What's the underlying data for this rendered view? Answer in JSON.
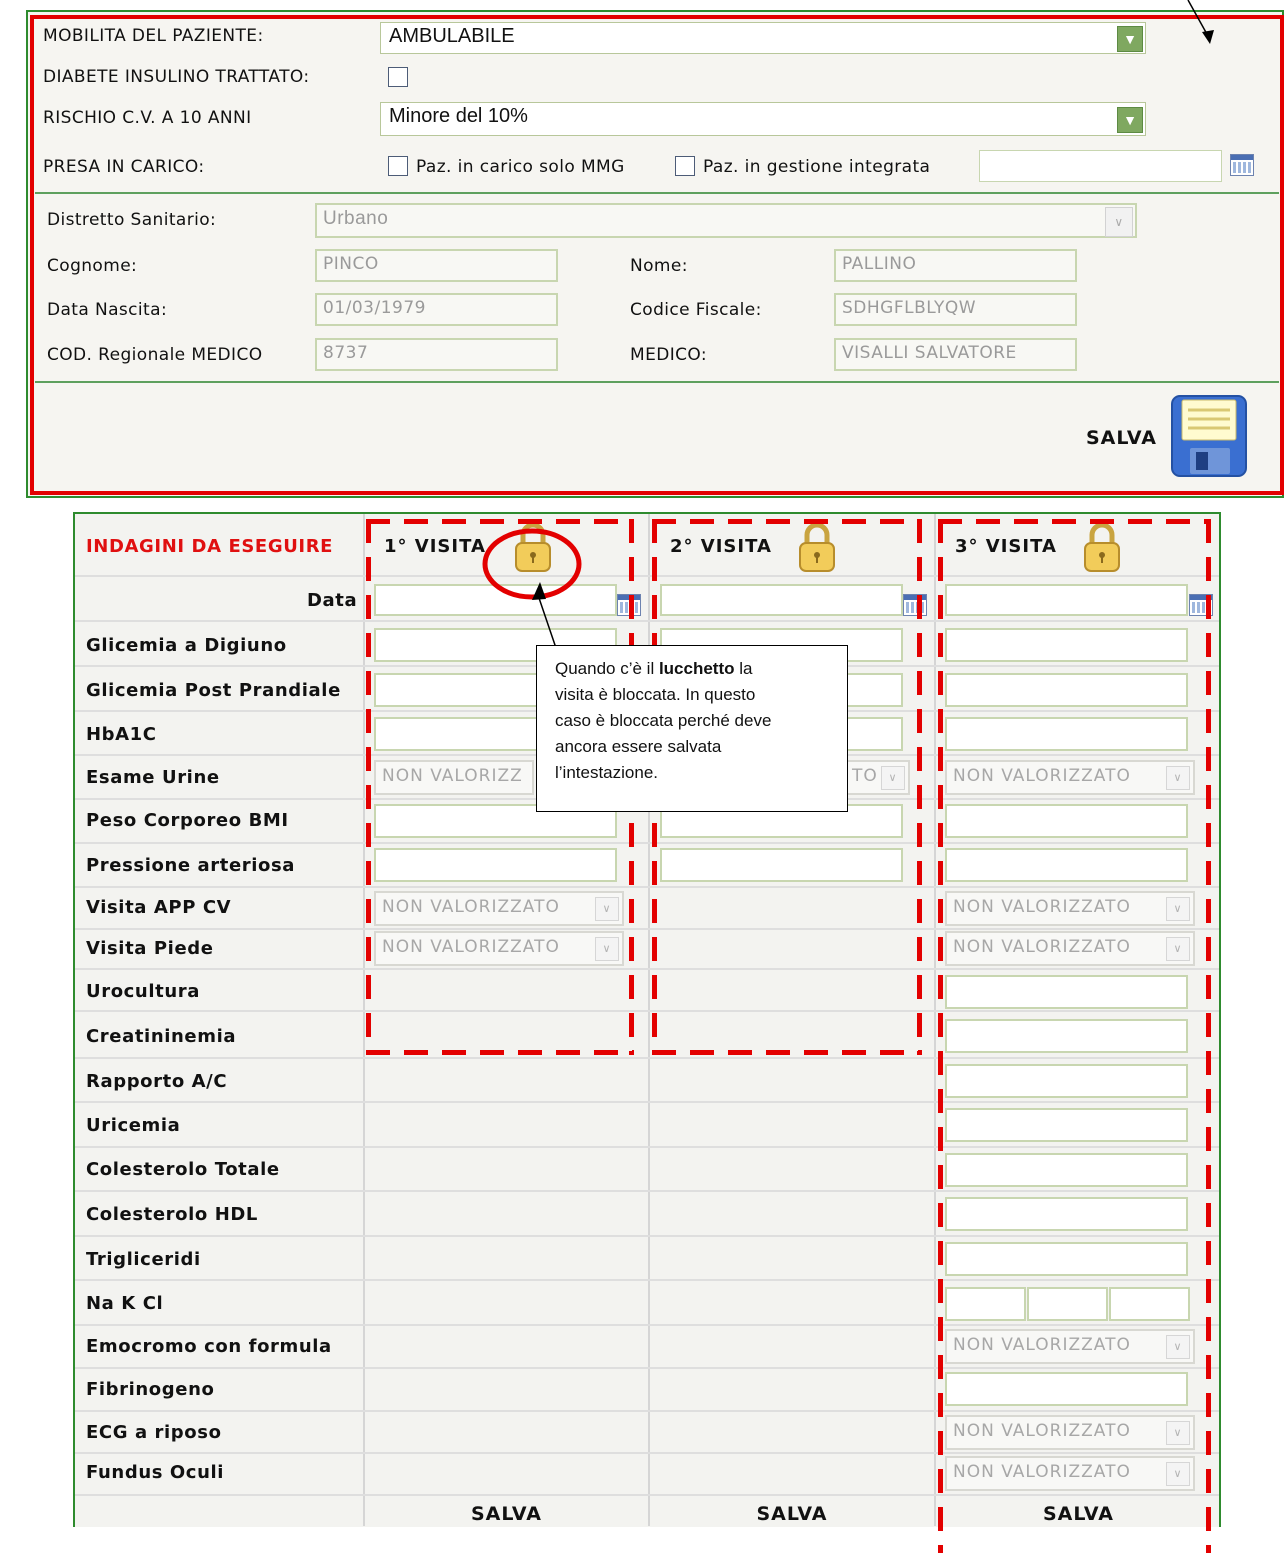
{
  "header_form": {
    "mobilita_label": "MOBILITA DEL PAZIENTE:",
    "mobilita_value": "AMBULABILE",
    "diabete_label": "DIABETE INSULINO TRATTATO:",
    "rischio_label": "RISCHIO C.V. A 10 ANNI",
    "rischio_value": "Minore del 10%",
    "presa_label": "PRESA IN CARICO:",
    "opt_mmg": "Paz. in carico solo MMG",
    "opt_integrata": "Paz. in gestione integrata",
    "distretto_label": "Distretto Sanitario:",
    "distretto_value": "Urbano",
    "cognome_label": "Cognome:",
    "cognome_value": "PINCO",
    "nome_label": "Nome:",
    "nome_value": "PALLINO",
    "nascita_label": "Data Nascita:",
    "nascita_value": "01/03/1979",
    "cf_label": "Codice Fiscale:",
    "cf_value": "SDHGFLBLYQW",
    "codreg_label": "COD. Regionale MEDICO",
    "codreg_value": "8737",
    "medico_label": "MEDICO:",
    "medico_value": "VISALLI SALVATORE",
    "save_label": "SALVA"
  },
  "table": {
    "title": "INDAGINI DA ESEGUIRE",
    "visits": [
      "1° VISITA",
      "2° VISITA",
      "3° VISITA"
    ],
    "rows": [
      "Data",
      "Glicemia a Digiuno",
      "Glicemia Post Prandiale",
      "HbA1C",
      "Esame Urine",
      "Peso Corporeo BMI",
      "Pressione arteriosa",
      "Visita APP CV",
      "Visita Piede",
      "Urocultura",
      "Creatininemia",
      "Rapporto A/C",
      "Uricemia",
      "Colesterolo Totale",
      "Colesterolo HDL",
      "Trigliceridi",
      "Na K Cl",
      "Emocromo con formula",
      "Fibrinogeno",
      "ECG a riposo",
      "Fundus Oculi"
    ],
    "select_value": "NON VALORIZZATO",
    "select_value_partial_2": "TO",
    "select_value_partial_1": "NON VALORIZZ",
    "save_labels": [
      "SALVA",
      "SALVA",
      "SALVA"
    ]
  },
  "callout": {
    "line1_pre": "Quando c’è il ",
    "line1_bold": "lucchetto",
    "line1_post": " la",
    "line2": "visita è bloccata. In questo",
    "line3": "caso è bloccata perché deve",
    "line4": "ancora essere salvata",
    "line5": "l’intestazione."
  },
  "colors": {
    "panel_border": "#2e8b2e",
    "highlight_red": "#e30000",
    "title_red": "#e01010",
    "background": "#f6f5f1"
  },
  "icons": [
    "calendar-icon",
    "lock-icon",
    "save-disk-icon",
    "dropdown-arrow-icon"
  ]
}
